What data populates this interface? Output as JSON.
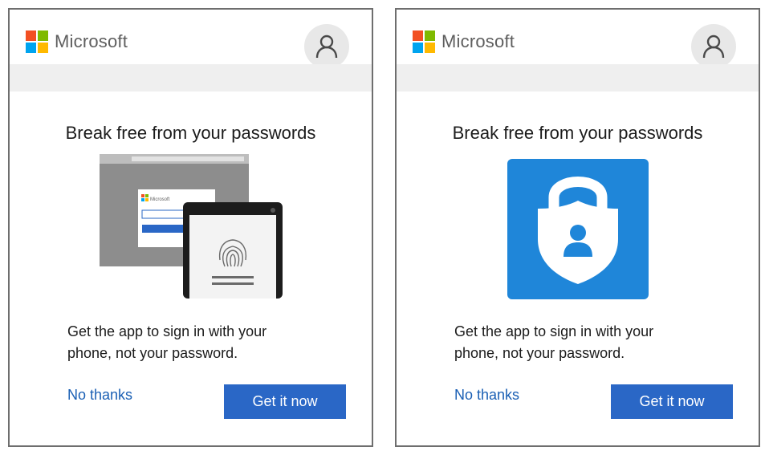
{
  "cards": [
    {
      "brand": "Microsoft",
      "title": "Break free from your passwords",
      "description_line1": "Get the app to sign in with your",
      "description_line2": "phone, not your password.",
      "secondary_action": "No thanks",
      "primary_action": "Get it now",
      "illustration": "laptop-and-phone-fingerprint",
      "illustration_brand": "Microsoft"
    },
    {
      "brand": "Microsoft",
      "title": "Break free from your passwords",
      "description_line1": "Get the app to sign in with your",
      "description_line2": "phone, not your password.",
      "secondary_action": "No thanks",
      "primary_action": "Get it now",
      "illustration": "authenticator-shield-lock-icon"
    }
  ],
  "colors": {
    "button": "#2a67c6",
    "link": "#1a5fb4",
    "authenticator_tile": "#1f86d9",
    "header_band": "#efefef"
  }
}
